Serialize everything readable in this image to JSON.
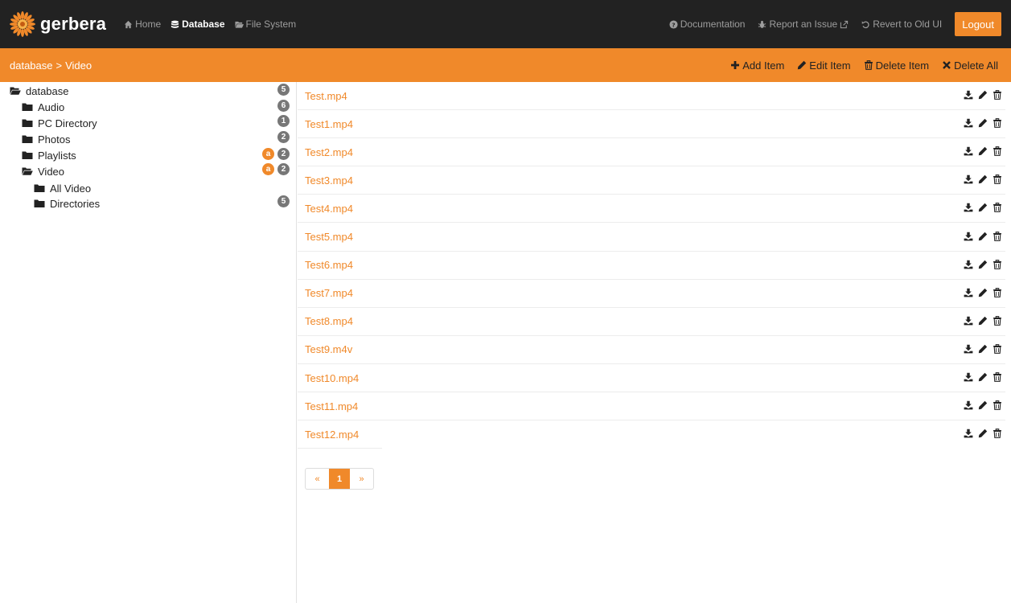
{
  "navbar": {
    "brand": "gerbera",
    "links": [
      {
        "label": "Home",
        "icon": "home-icon",
        "active": false
      },
      {
        "label": "Database",
        "icon": "database-icon",
        "active": true
      },
      {
        "label": "File System",
        "icon": "folder-open-icon",
        "active": false
      }
    ],
    "right_links": [
      {
        "label": "Documentation",
        "icon": "question-circle-icon"
      },
      {
        "label": "Report an Issue",
        "icon": "bug-icon",
        "trailing_icon": "external-link-icon"
      },
      {
        "label": "Revert to Old UI",
        "icon": "undo-icon"
      }
    ],
    "logout_label": "Logout"
  },
  "subbar": {
    "breadcrumb": [
      "database",
      ">",
      "Video"
    ],
    "actions": [
      {
        "label": "Add Item",
        "icon": "plus-icon"
      },
      {
        "label": "Edit Item",
        "icon": "pencil-icon"
      },
      {
        "label": "Delete Item",
        "icon": "trash-icon"
      },
      {
        "label": "Delete All",
        "icon": "times-icon"
      }
    ]
  },
  "tree": [
    {
      "label": "database",
      "icon": "folder-open-icon",
      "badge": "5"
    },
    {
      "label": "Audio",
      "icon": "folder-icon",
      "badge": "6"
    },
    {
      "label": "PC Directory",
      "icon": "folder-icon",
      "badge": "1"
    },
    {
      "label": "Photos",
      "icon": "folder-icon",
      "badge": "2"
    },
    {
      "label": "Playlists",
      "icon": "folder-icon",
      "badge": "2",
      "auto_badge": "a"
    },
    {
      "label": "Video",
      "icon": "folder-open-icon",
      "badge": "2",
      "auto_badge": "a"
    },
    {
      "label": "All Video",
      "icon": "folder-icon"
    },
    {
      "label": "Directories",
      "icon": "folder-icon",
      "badge": "5"
    }
  ],
  "items": [
    "Test.mp4",
    "Test1.mp4",
    "Test2.mp4",
    "Test3.mp4",
    "Test4.mp4",
    "Test5.mp4",
    "Test6.mp4",
    "Test7.mp4",
    "Test8.mp4",
    "Test9.m4v",
    "Test10.mp4",
    "Test11.mp4",
    "Test12.mp4"
  ],
  "item_tool_icons": [
    "download-icon",
    "pencil-icon",
    "trash-icon"
  ],
  "pagination": {
    "prev": "«",
    "current": "1",
    "next": "»"
  },
  "colors": {
    "accent": "#f0892a",
    "navbar": "#222222",
    "badge_gray": "#777777"
  }
}
